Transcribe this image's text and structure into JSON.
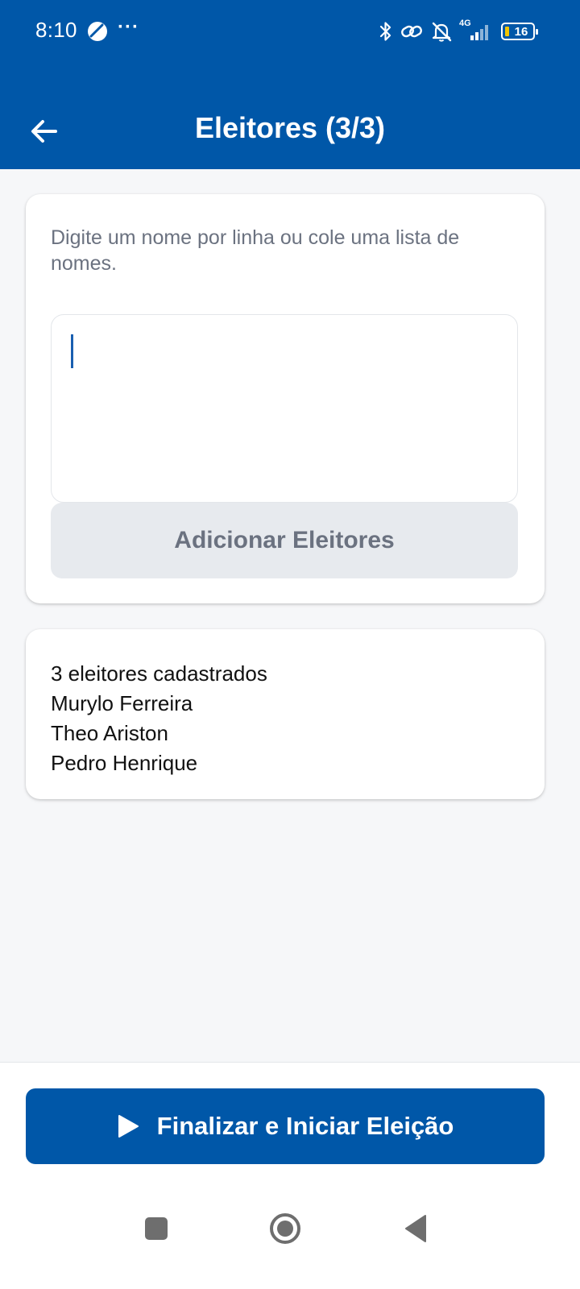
{
  "status_bar": {
    "time": "8:10",
    "more_indicator": "···",
    "network": "4G",
    "battery": "16",
    "icons": [
      "bluetooth-icon",
      "link-icon",
      "bell-off-icon",
      "signal-icon",
      "battery-icon"
    ]
  },
  "header": {
    "title": "Eleitores (3/3)",
    "back_icon": "arrow-left-icon"
  },
  "input_card": {
    "instructions": "Digite um nome por linha ou cole uma lista de nomes.",
    "textarea_value": "",
    "add_button_label": "Adicionar Eleitores"
  },
  "voters_card": {
    "count_label": "3 eleitores cadastrados",
    "voters": [
      "Murylo Ferreira",
      "Theo Ariston",
      "Pedro Henrique"
    ]
  },
  "footer": {
    "primary_button_label": "Finalizar e Iniciar Eleição",
    "primary_button_icon": "play-icon"
  },
  "nav": {
    "icons": [
      "recent-apps-icon",
      "home-icon",
      "back-icon"
    ]
  },
  "colors": {
    "primary": "#0057a8",
    "background": "#f6f7f9",
    "muted_text": "#6b7280",
    "disabled_button": "#e7eaee"
  }
}
